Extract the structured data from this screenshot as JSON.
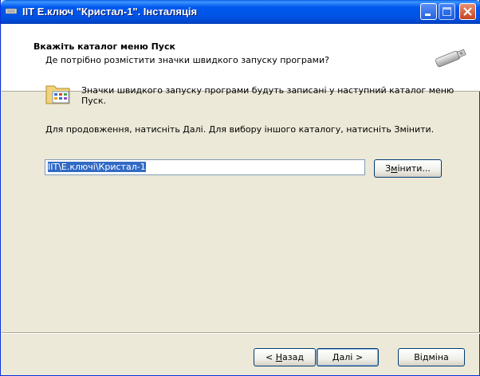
{
  "window": {
    "title": "IIT Е.ключ \"Кристал-1\". Інсталяція",
    "icons": [
      "app-icon",
      "minimize-icon",
      "maximize-icon",
      "close-icon"
    ]
  },
  "header": {
    "title": "Вкажіть каталог меню Пуск",
    "subtitle": "Де потрібно розмістити значки швидкого запуску програми?",
    "icon": "usb-key-icon"
  },
  "body": {
    "folder_icon": "start-menu-folder-icon",
    "info": "Значки швидкого запуску програми будуть записані у наступний каталог меню Пуск.",
    "instruction": "Для продовження, натисніть Далі. Для вибору іншого каталогу, натисніть Змінити.",
    "path_value": "IIT\\Е.ключі\\Кристал-1"
  },
  "buttons": {
    "change_pre": "З",
    "change_ul": "м",
    "change_post": "інити...",
    "back_pre": "< ",
    "back_ul": "Н",
    "back_post": "азад",
    "next_ul": "Д",
    "next_post": "алі >",
    "cancel": "Відміна"
  }
}
